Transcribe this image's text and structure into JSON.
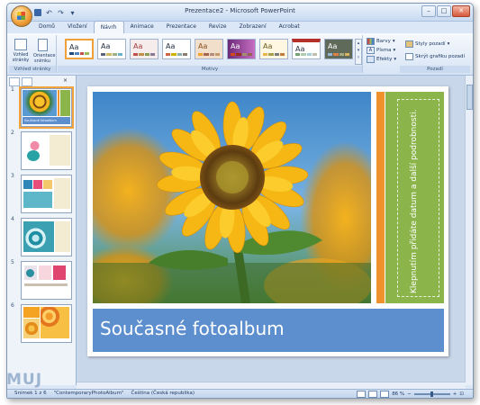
{
  "window": {
    "title": "Prezentace2 - Microsoft PowerPoint"
  },
  "ribbon_tabs": [
    "Domů",
    "Vložení",
    "Návrh",
    "Animace",
    "Prezentace",
    "Revize",
    "Zobrazení",
    "Acrobat"
  ],
  "active_tab": "Návrh",
  "page_setup": {
    "btn1": "Vzhled stránky",
    "btn2": "Orientace snímku",
    "label": "Vzhled stránky"
  },
  "themes": {
    "label": "Motivy"
  },
  "theme_options": {
    "colors": "Barvy",
    "fonts": "Písma",
    "effects": "Efekty"
  },
  "background": {
    "styles": "Styly pozadí",
    "hide": "Skrýt grafiku pozadí",
    "label": "Pozadí"
  },
  "slide": {
    "title": "Současné fotoalbum",
    "side_placeholder": "Klepnutím přidáte datum a další podrobnosti."
  },
  "thumbnail_numbers": [
    "1",
    "2",
    "3",
    "4",
    "5",
    "6"
  ],
  "thumbnail1_caption": "Současné fotoalbum",
  "status": {
    "slide": "Snímek 1 z 6",
    "theme": "\"ContemporaryPhotoAlbum\"",
    "language": "Čeština (Česká republika)",
    "zoom": "86 %"
  },
  "watermark": "MUJ"
}
